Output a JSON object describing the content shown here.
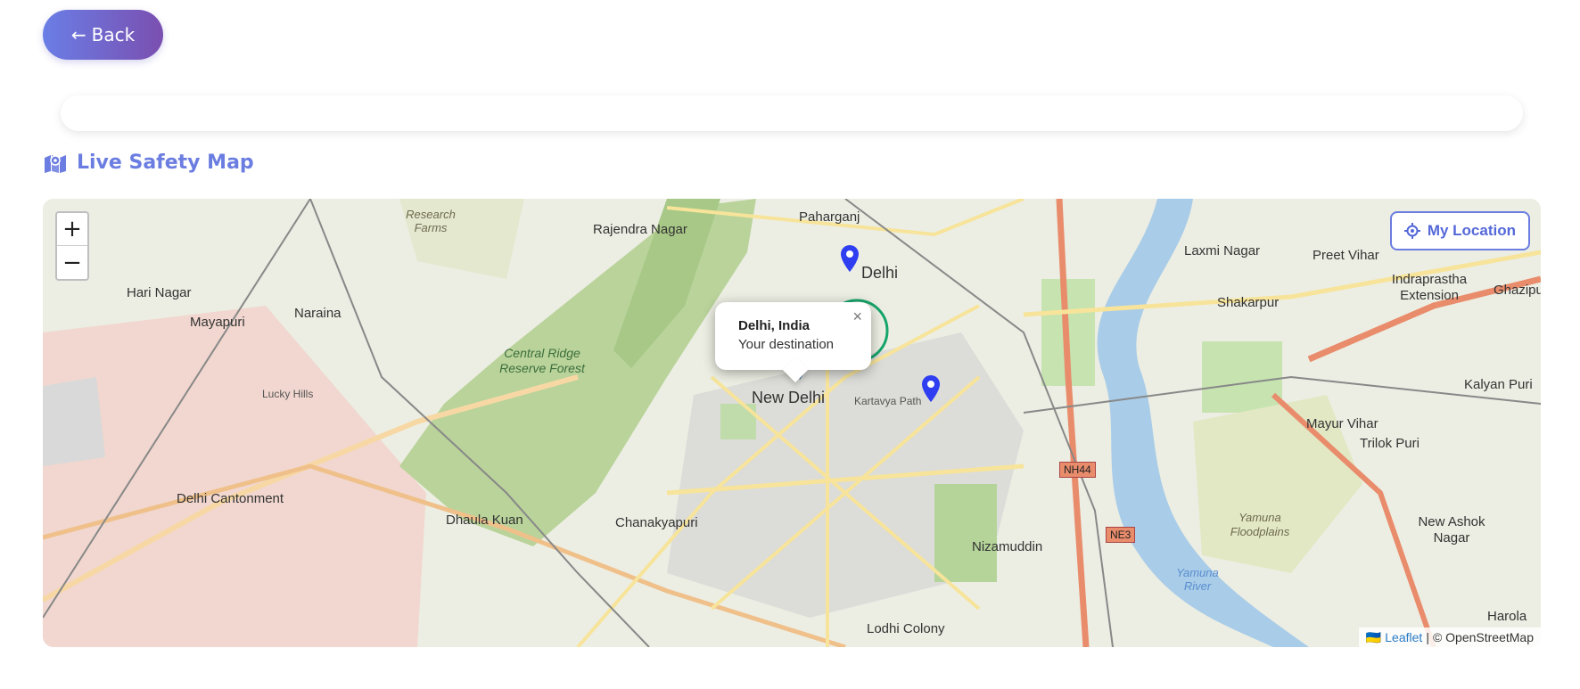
{
  "back_button": {
    "arrow": "←",
    "label": "Back"
  },
  "section": {
    "title": "Live Safety Map",
    "icon": "map-icon"
  },
  "map": {
    "zoom_in": "+",
    "zoom_out": "−",
    "my_location": "My Location",
    "popup": {
      "title": "Delhi, India",
      "subtitle": "Your destination",
      "close": "×"
    },
    "attribution": {
      "flag": "🇺🇦",
      "leaflet": "Leaflet",
      "separator": " | ",
      "osm": "© OpenStreetMap"
    },
    "colors": {
      "accent": "#6b7de0",
      "marker_blue": "#2e3ef0",
      "marker_default": "#2b7ccb",
      "safe_zone": "#17a56b"
    },
    "labels": [
      "Paharganj",
      "Rajendra Nagar",
      "Delhi",
      "Hari Nagar",
      "Mayapuri",
      "Naraina",
      "New Delhi",
      "Laxmi Nagar",
      "Preet Vihar",
      "Shakarpur",
      "Indraprastha Extension",
      "Ghazipur",
      "Kalyan Puri",
      "Mayur Vihar",
      "Trilok Puri",
      "Delhi Cantonment",
      "Dhaula Kuan",
      "Chanakyapuri",
      "Nizamuddin",
      "Lodhi Colony",
      "New Ashok Nagar",
      "Harola",
      "Lucky Hills",
      "Kartavya Path"
    ],
    "green_labels": [
      "Central Ridge Reserve Forest",
      "Research Farms",
      "Yamuna Floodplains"
    ],
    "river_labels": [
      "Yamuna River"
    ],
    "road_tags": [
      "NH44",
      "NE3"
    ]
  }
}
